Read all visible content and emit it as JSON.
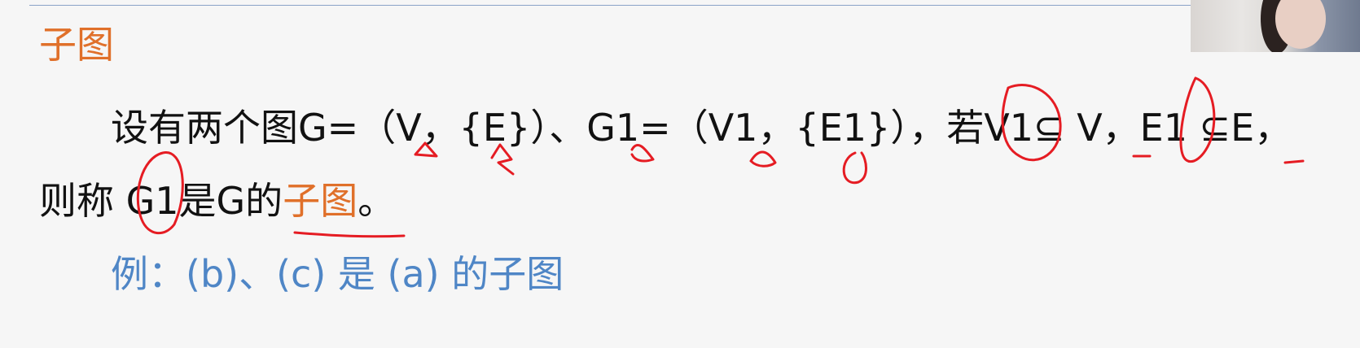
{
  "slide": {
    "title": "子图",
    "definition_line1": "设有两个图G=（V，{E}）、G1=（V1，{E1}），若V1⊆ V，E1 ⊆E，",
    "definition_line2_prefix": "则称 G1是G的",
    "definition_line2_term": "子图",
    "definition_line2_suffix": "。",
    "example": "例：(b)、(c) 是 (a) 的子图"
  },
  "colors": {
    "title": "#e0702a",
    "body_text": "#111111",
    "example": "#4f86c6",
    "annotation": "#e51c23",
    "background": "#f6f6f6"
  }
}
